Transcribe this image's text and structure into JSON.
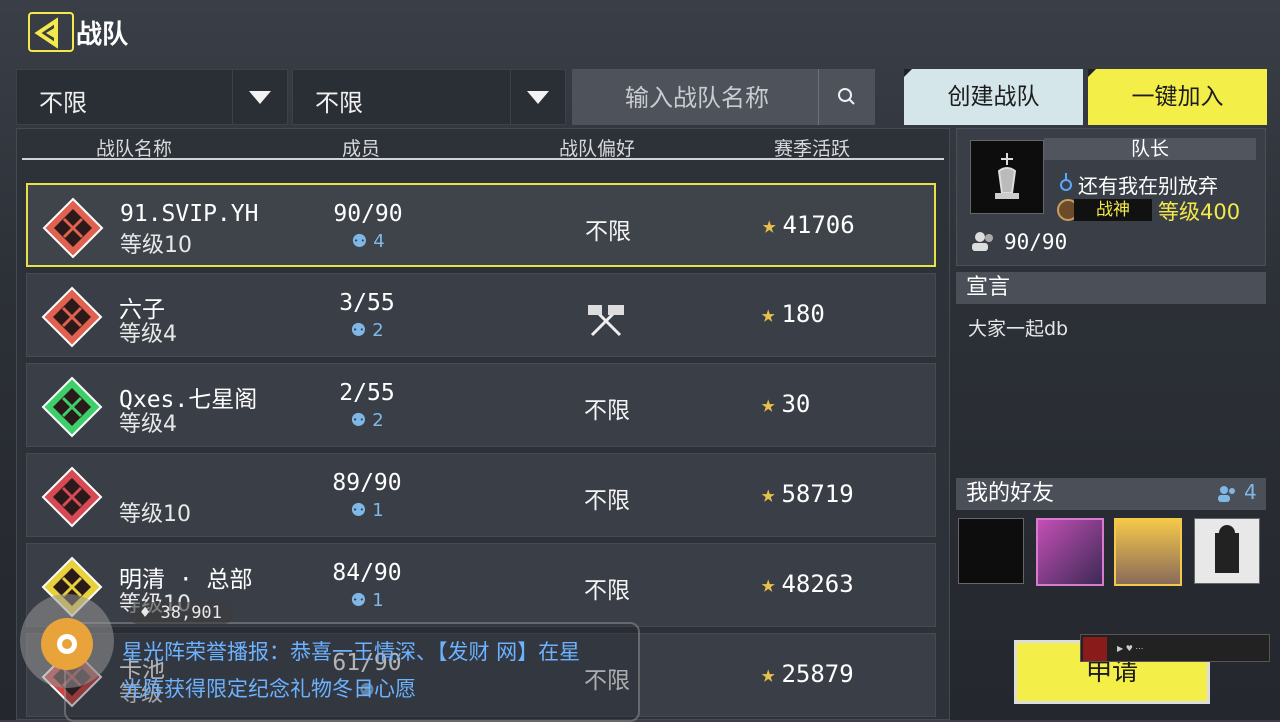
{
  "header": {
    "title": "战队",
    "back_icon": "back-arrow-icon"
  },
  "filters": {
    "filter1": "不限",
    "filter2": "不限",
    "search_placeholder": "输入战队名称"
  },
  "actions": {
    "create": "创建战队",
    "join": "一键加入"
  },
  "table": {
    "columns": [
      "战队名称",
      "成员",
      "战队偏好",
      "赛季活跃"
    ],
    "rows": [
      {
        "name": "91.SVIP.YH",
        "level": "等级10",
        "members": "90/90",
        "online": "4",
        "preference": "不限",
        "activity": "41706",
        "badge_color": "#e0614f"
      },
      {
        "name": "六子",
        "level": "等级4",
        "members": "3/55",
        "online": "2",
        "preference": "",
        "activity": "180",
        "badge_color": "#e0614f"
      },
      {
        "name": "Qxes.七星阁",
        "level": "等级4",
        "members": "2/55",
        "online": "2",
        "preference": "不限",
        "activity": "30",
        "badge_color": "#3ecf6a"
      },
      {
        "name": "",
        "level": "等级10",
        "members": "89/90",
        "online": "1",
        "preference": "不限",
        "activity": "58719",
        "badge_color": "#d64a56"
      },
      {
        "name": "明清 · 总部",
        "level": "等级10",
        "members": "84/90",
        "online": "1",
        "preference": "不限",
        "activity": "48263",
        "badge_color": "#e8d13a"
      },
      {
        "name": "卡池",
        "level": "等级",
        "members": "61/90",
        "online": "",
        "preference": "不限",
        "activity": "25879",
        "badge_color": "#c44"
      }
    ]
  },
  "captain": {
    "label": "队长",
    "name": "还有我在别放弃",
    "rank": "战神",
    "level": "等级400",
    "count": "90/90"
  },
  "declaration": {
    "label": "宣言",
    "text": "大家一起db"
  },
  "friends": {
    "label": "我的好友",
    "count": "4"
  },
  "apply_button": "申请",
  "overlay": {
    "viewers": "38,901",
    "broadcast": "星光阵荣誉播报：恭喜一王情深、【发财 网】在星光阵获得限定纪念礼物冬日心愿"
  },
  "colors": {
    "accent_yellow": "#f4ef48",
    "create_bg": "#d4e6ea",
    "online_blue": "#7fb8e6"
  }
}
